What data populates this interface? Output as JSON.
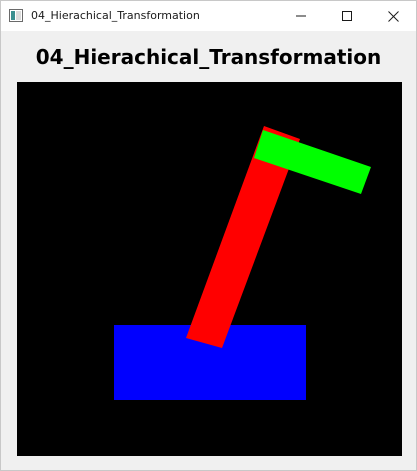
{
  "window": {
    "title": "04_Hierachical_Transformation",
    "icon": "app-window-icon",
    "controls": {
      "minimize_icon": "minimize-icon",
      "maximize_icon": "maximize-icon",
      "close_icon": "close-icon"
    }
  },
  "header": {
    "title": "04_Hierachical_Transformation"
  },
  "scene": {
    "background": "#000000",
    "parts": [
      {
        "name": "base",
        "color": "#0000ff"
      },
      {
        "name": "upper-arm",
        "color": "#ff0000"
      },
      {
        "name": "forearm",
        "color": "#00ff00"
      }
    ]
  }
}
